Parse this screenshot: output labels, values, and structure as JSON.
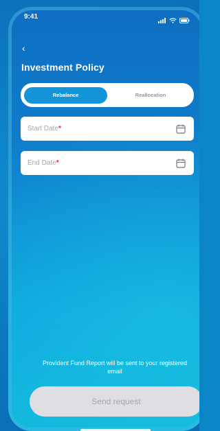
{
  "status_bar": {
    "time": "9:41",
    "icons": [
      "signal-icon",
      "wifi-icon",
      "battery-icon"
    ]
  },
  "header": {
    "back_icon": "chevron-left-icon",
    "title": "Investment Policy"
  },
  "tabs": [
    {
      "label": "Rebalance",
      "active": true
    },
    {
      "label": "Reallocation",
      "active": false
    }
  ],
  "fields": {
    "start_date": {
      "label": "Start Date",
      "required_mark": "*",
      "icon": "calendar-icon"
    },
    "end_date": {
      "label": "End Date",
      "required_mark": "*",
      "icon": "calendar-icon"
    }
  },
  "notice": "Provident Fund Report will be sent to your registered email",
  "actions": {
    "send_label": "Send request"
  },
  "colors": {
    "accent": "#1595d9",
    "required": "#e12a2a",
    "disabled_button": "#dfdfe3"
  }
}
